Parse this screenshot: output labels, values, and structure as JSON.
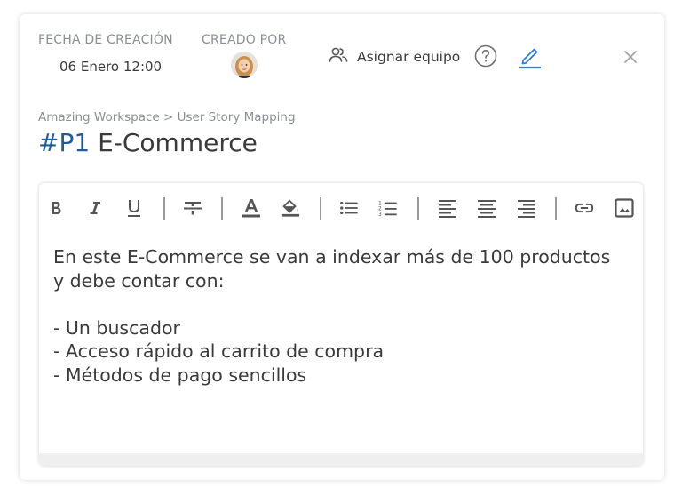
{
  "meta": {
    "created_label": "FECHA DE CREACIÓN",
    "created_value": "06 Enero 12:00",
    "created_by_label": "CREADO POR"
  },
  "actions": {
    "assign_team": "Asignar equipo"
  },
  "breadcrumb": "Amazing Workspace > User Story Mapping",
  "title": {
    "code": "#P1",
    "name": "E-Commerce"
  },
  "toolbar": {
    "items": [
      "bold-icon",
      "italic-icon",
      "underline-icon",
      "strikethrough-icon",
      "text-color-icon",
      "highlight-icon",
      "bullet-list-icon",
      "numbered-list-icon",
      "align-left-icon",
      "align-center-icon",
      "align-right-icon",
      "link-icon",
      "image-icon"
    ]
  },
  "content": {
    "line1": "En este E-Commerce se van a indexar más de 100 productos",
    "line2": "y debe contar con:",
    "line3": "",
    "line4": "- Un buscador",
    "line5": "- Acceso rápido al carrito de compra",
    "line6": "- Métodos de pago sencillos"
  },
  "colors": {
    "accent": "#1e5c9a",
    "edit_icon": "#2f7de1",
    "muted": "#8b8f94"
  }
}
